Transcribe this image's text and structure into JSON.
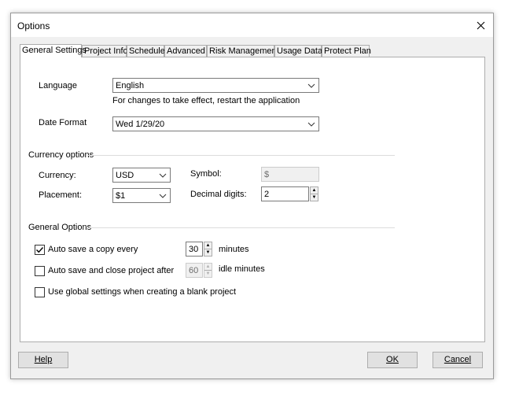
{
  "window": {
    "title": "Options"
  },
  "tabs": [
    {
      "label": "General Settings",
      "active": true
    },
    {
      "label": "Project Info"
    },
    {
      "label": "Schedule"
    },
    {
      "label": "Advanced"
    },
    {
      "label": "Risk Management"
    },
    {
      "label": "Usage Data"
    },
    {
      "label": "Protect Plan"
    }
  ],
  "language": {
    "label": "Language",
    "value": "English",
    "hint": "For changes to take effect, restart the application"
  },
  "date_format": {
    "label": "Date Format",
    "value": "Wed 1/29/20"
  },
  "currency_options": {
    "heading": "Currency options",
    "currency_label": "Currency:",
    "currency_value": "USD",
    "placement_label": "Placement:",
    "placement_value": "$1",
    "symbol_label": "Symbol:",
    "symbol_value": "$",
    "decimal_label": "Decimal digits:",
    "decimal_value": "2"
  },
  "general_options": {
    "heading": "General Options",
    "autosave_label": "Auto save a copy every",
    "autosave_checked": true,
    "autosave_value": "30",
    "autosave_unit": "minutes",
    "autoclose_label": "Auto save and close project after",
    "autoclose_checked": false,
    "autoclose_value": "60",
    "autoclose_unit": "idle minutes",
    "global_label": "Use global settings when creating a blank project",
    "global_checked": false
  },
  "buttons": {
    "help": "Help",
    "ok": "OK",
    "cancel": "Cancel"
  },
  "icons": {
    "close": "close-icon",
    "dropdown": "chevron-down-icon",
    "spin_up": "arrow-up-icon",
    "spin_down": "arrow-down-icon",
    "check": "check-icon"
  },
  "colors": {
    "dialog_bg": "#f0f0f0",
    "panel_bg": "#ffffff",
    "border": "#adadad"
  }
}
